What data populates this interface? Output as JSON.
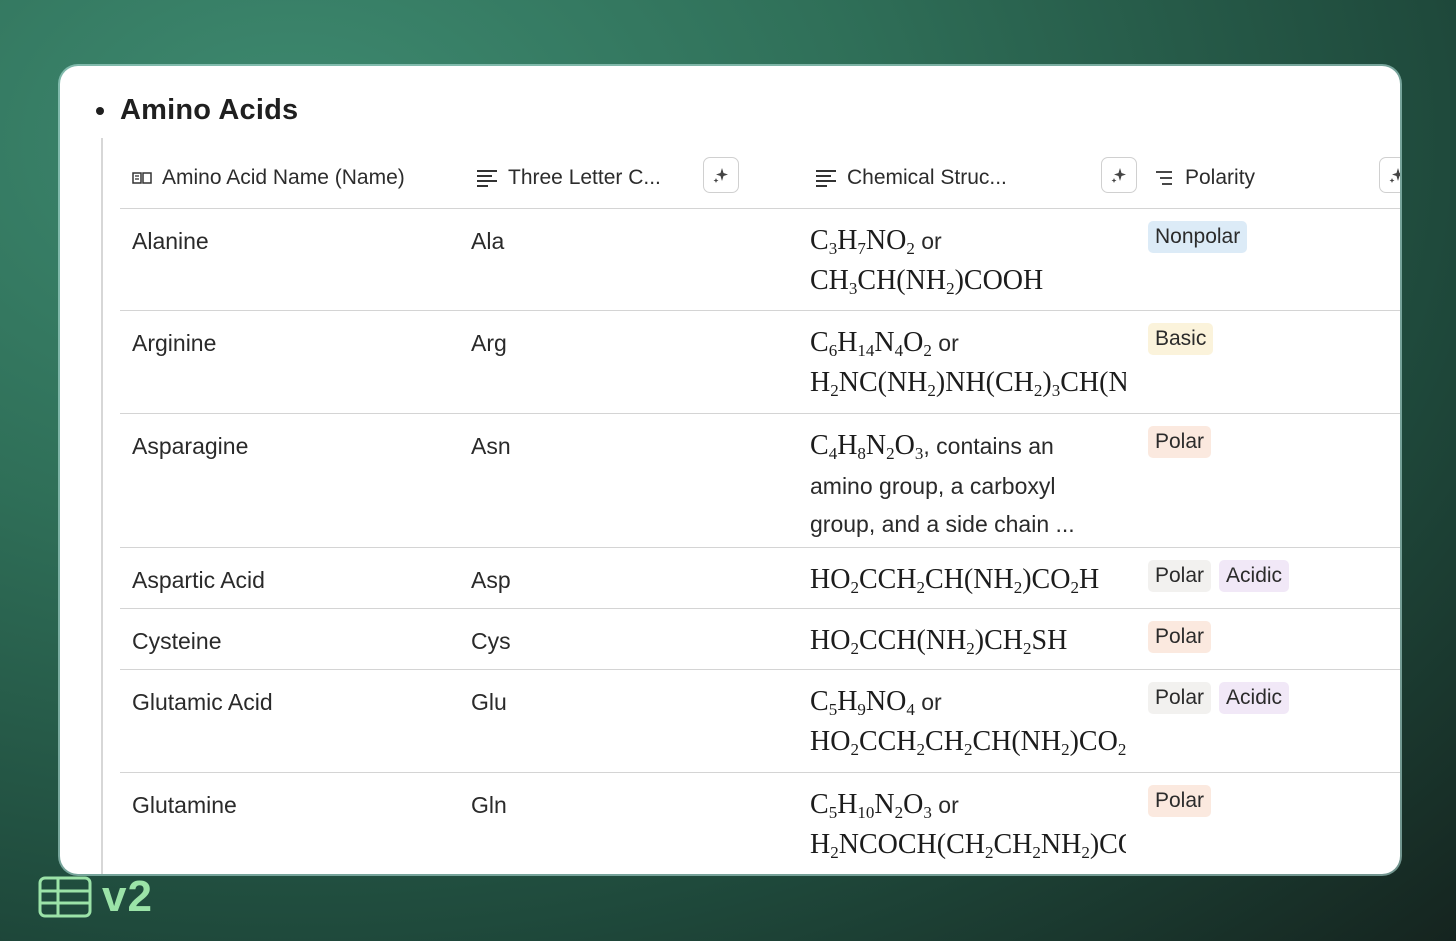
{
  "page": {
    "title": "Amino Acids"
  },
  "table": {
    "columns": [
      {
        "label": "Amino Acid Name (Name)",
        "icon": "title-property-icon",
        "has_ai_button": false
      },
      {
        "label": "Three Letter C...",
        "icon": "text-lines-icon",
        "has_ai_button": true
      },
      {
        "label": "Chemical Struc...",
        "icon": "text-lines-icon",
        "has_ai_button": true
      },
      {
        "label": "Polarity",
        "icon": "multi-select-icon",
        "has_ai_button": true
      }
    ],
    "rows": [
      {
        "name": "Alanine",
        "code": "Ala",
        "tags": [
          {
            "label": "Nonpolar",
            "color": "#dcebf7"
          }
        ]
      },
      {
        "name": "Arginine",
        "code": "Arg",
        "tags": [
          {
            "label": "Basic",
            "color": "#fbf3db"
          }
        ]
      },
      {
        "name": "Asparagine",
        "code": "Asn",
        "tags": [
          {
            "label": "Polar",
            "color": "#fbe9df"
          }
        ]
      },
      {
        "name": "Aspartic Acid",
        "code": "Asp",
        "tags": [
          {
            "label": "Polar",
            "color": "#f2f1ef"
          },
          {
            "label": "Acidic",
            "color": "#f1e8f7"
          }
        ]
      },
      {
        "name": "Cysteine",
        "code": "Cys",
        "tags": [
          {
            "label": "Polar",
            "color": "#fbe9df"
          }
        ]
      },
      {
        "name": "Glutamic Acid",
        "code": "Glu",
        "tags": [
          {
            "label": "Polar",
            "color": "#f2f1ef"
          },
          {
            "label": "Acidic",
            "color": "#f1e8f7"
          }
        ]
      },
      {
        "name": "Glutamine",
        "code": "Gln",
        "tags": [
          {
            "label": "Polar",
            "color": "#fbe9df"
          }
        ]
      }
    ],
    "chem": {
      "or": "or",
      "asn_text_1": ", contains an",
      "asn_text_2": "amino group, a carboxyl",
      "asn_text_3": "group, and a side chain ..."
    }
  },
  "logo": {
    "text": "v2",
    "icon": "table-icon",
    "color": "#9be3a8"
  }
}
